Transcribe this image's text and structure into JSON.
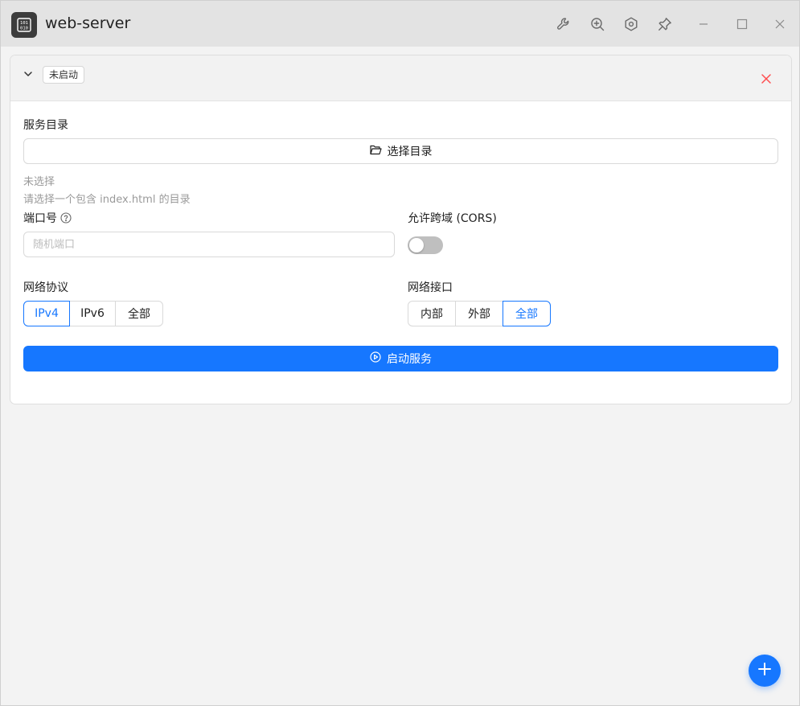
{
  "window": {
    "title": "web-server",
    "app_icon": "binary-file-icon",
    "toolbar_icons": [
      "wrench-icon",
      "zoom-in-icon",
      "settings-hex-icon",
      "pin-icon",
      "minimize-icon",
      "maximize-icon",
      "close-icon"
    ]
  },
  "card": {
    "status_tag": "未启动",
    "directory": {
      "label": "服务目录",
      "button_label": "选择目录",
      "selected_text": "未选择",
      "hint": "请选择一个包含 index.html 的目录"
    },
    "port": {
      "label": "端口号",
      "placeholder": "随机端口",
      "value": ""
    },
    "cors": {
      "label": "允许跨域 (CORS)",
      "enabled": false
    },
    "protocol": {
      "label": "网络协议",
      "options": [
        "IPv4",
        "IPv6",
        "全部"
      ],
      "selected": "IPv4"
    },
    "interface": {
      "label": "网络接口",
      "options": [
        "内部",
        "外部",
        "全部"
      ],
      "selected": "全部"
    },
    "start_button_label": "启动服务"
  },
  "colors": {
    "accent": "#1677ff",
    "danger": "#ff4d4f",
    "titlebar": "#e3e3e3",
    "background": "#f3f3f3"
  }
}
